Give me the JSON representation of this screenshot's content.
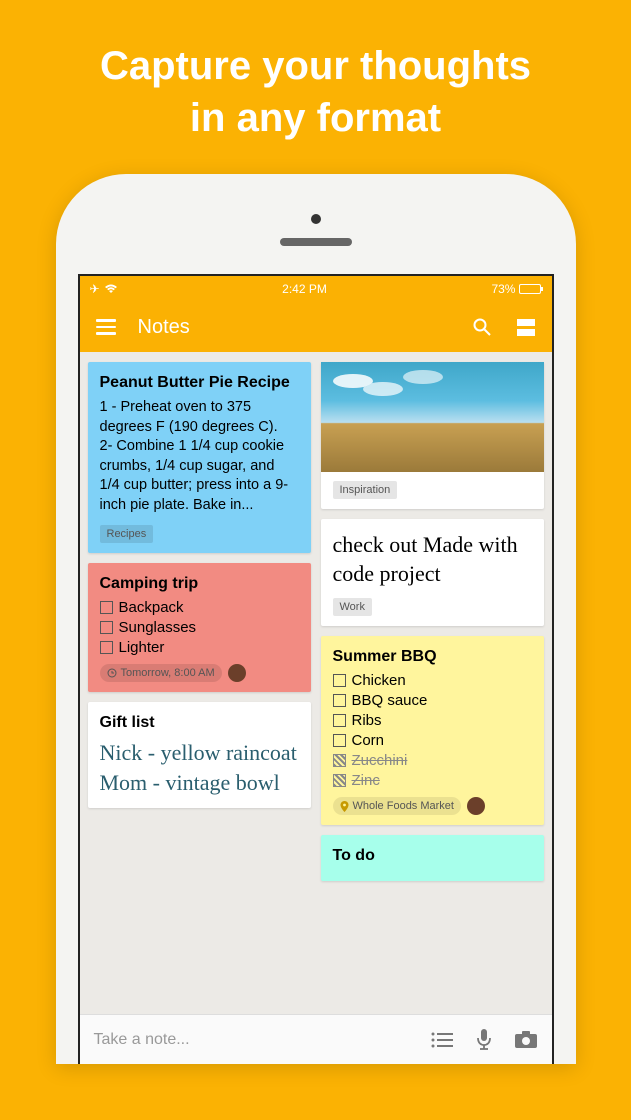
{
  "hero": {
    "line1": "Capture your thoughts",
    "line2": "in any format"
  },
  "status": {
    "time": "2:42 PM",
    "battery_pct": "73%"
  },
  "app": {
    "title": "Notes"
  },
  "bottom": {
    "placeholder": "Take a note..."
  },
  "left": [
    {
      "title": "Peanut Butter Pie Recipe",
      "body": "1 - Preheat oven to 375 degrees F (190 degrees C).\n2- Combine 1 1/4 cup cookie crumbs, 1/4 cup sugar, and 1/4 cup butter; press into a 9-inch pie plate. Bake in...",
      "label": "Recipes"
    },
    {
      "title": "Camping trip",
      "items": [
        {
          "text": "Backpack",
          "done": false
        },
        {
          "text": "Sunglasses",
          "done": false
        },
        {
          "text": "Lighter",
          "done": false
        }
      ],
      "reminder": "Tomorrow, 8:00 AM"
    },
    {
      "title": "Gift list",
      "body": "Nick - yellow raincoat\nMom - vintage bowl"
    }
  ],
  "right": [
    {
      "label": "Inspiration"
    },
    {
      "body": "check out Made with code project",
      "label": "Work"
    },
    {
      "title": "Summer BBQ",
      "items": [
        {
          "text": "Chicken",
          "done": false
        },
        {
          "text": "BBQ sauce",
          "done": false
        },
        {
          "text": "Ribs",
          "done": false
        },
        {
          "text": "Corn",
          "done": false
        },
        {
          "text": "Zucchini",
          "done": true
        },
        {
          "text": "Zinc",
          "done": true
        }
      ],
      "location": "Whole Foods Market"
    },
    {
      "title": "To do"
    }
  ]
}
